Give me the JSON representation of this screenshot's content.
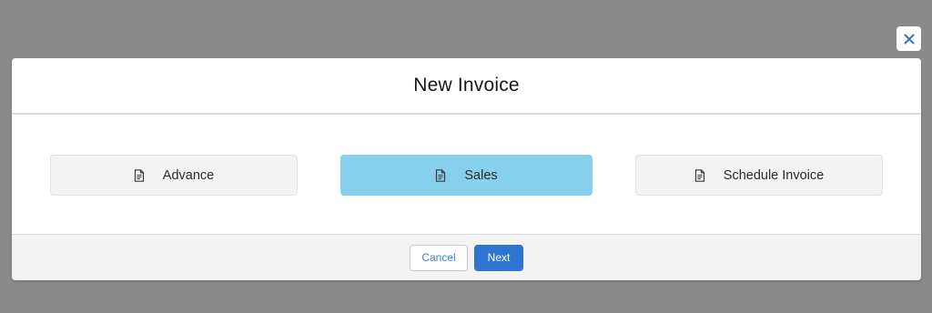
{
  "dialog": {
    "title": "New Invoice",
    "close_icon": "close-icon"
  },
  "options": [
    {
      "label": "Advance",
      "icon": "document-icon",
      "selected": false
    },
    {
      "label": "Sales",
      "icon": "document-icon",
      "selected": true
    },
    {
      "label": "Schedule Invoice",
      "icon": "document-icon",
      "selected": false
    }
  ],
  "footer": {
    "cancel_label": "Cancel",
    "next_label": "Next"
  },
  "colors": {
    "backdrop": "#8a8a8a",
    "selected_option": "#87d0ec",
    "primary_button": "#2e74d0",
    "link_text": "#3a7fcf"
  }
}
